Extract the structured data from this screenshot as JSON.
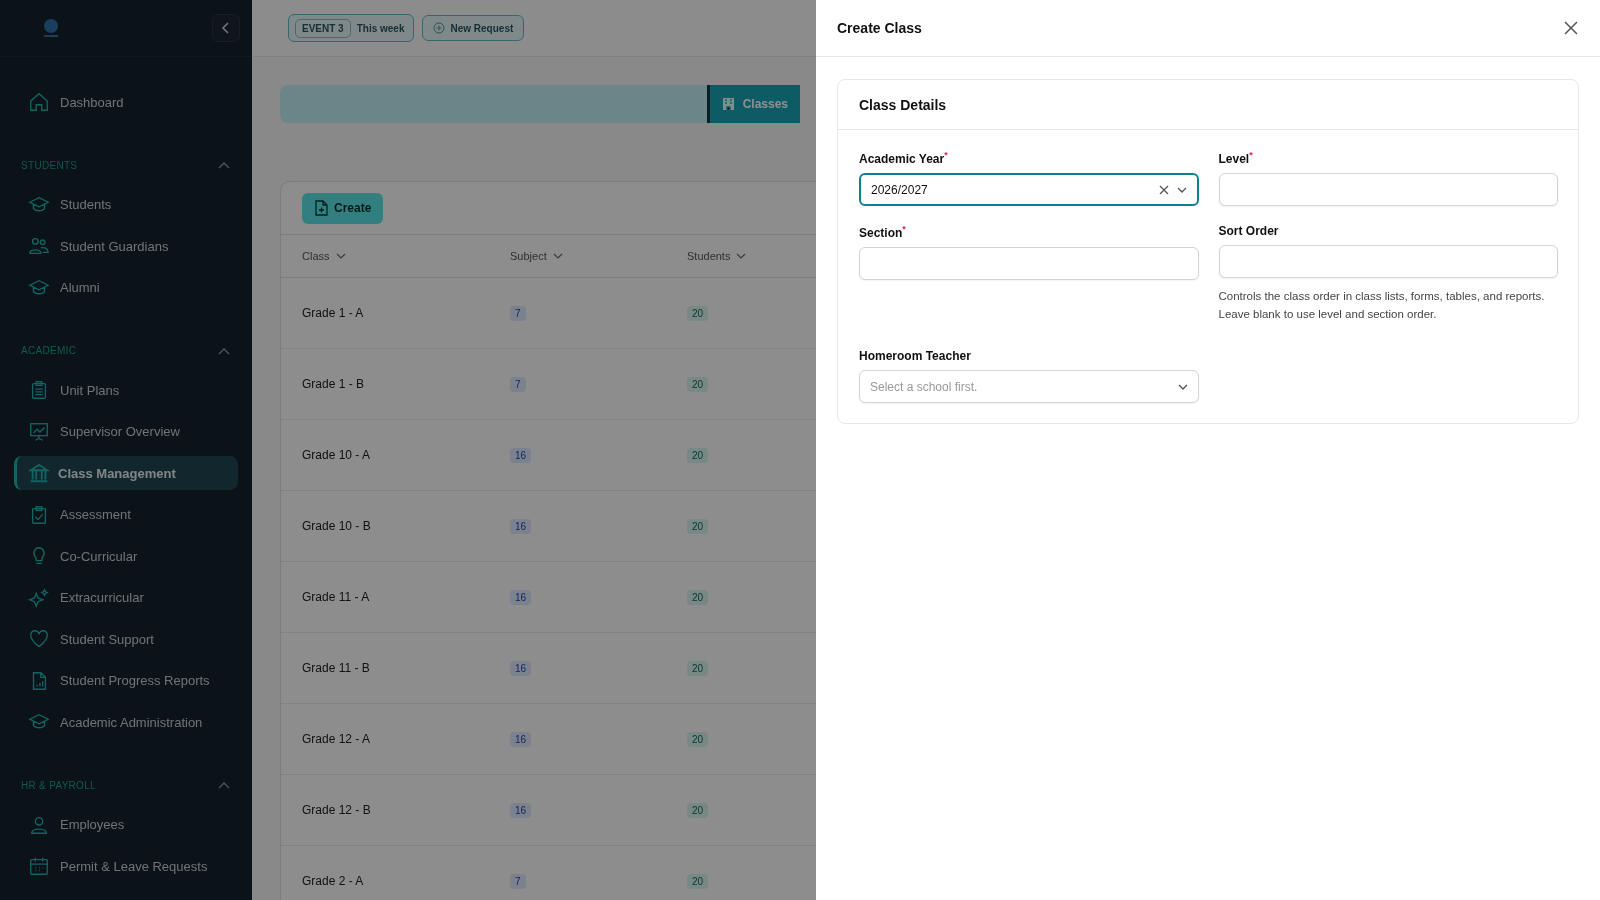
{
  "sidebar": {
    "groups": [
      {
        "items": [
          {
            "label": "Dashboard",
            "selected": false
          }
        ]
      },
      {
        "title": "STUDENTS",
        "expanded": true,
        "items": [
          {
            "label": "Students",
            "selected": false
          },
          {
            "label": "Student Guardians",
            "selected": false
          },
          {
            "label": "Alumni",
            "selected": false
          }
        ]
      },
      {
        "title": "ACADEMIC",
        "expanded": true,
        "items": [
          {
            "label": "Unit Plans",
            "selected": false
          },
          {
            "label": "Supervisor Overview",
            "selected": false
          },
          {
            "label": "Class Management",
            "selected": true
          },
          {
            "label": "Assessment",
            "selected": false
          },
          {
            "label": "Co-Curricular",
            "selected": false
          },
          {
            "label": "Extracurricular",
            "selected": false
          },
          {
            "label": "Student Support",
            "selected": false
          },
          {
            "label": "Student Progress Reports",
            "selected": false
          },
          {
            "label": "Academic Administration",
            "selected": false
          }
        ]
      },
      {
        "title": "HR & PAYROLL",
        "expanded": true,
        "items": [
          {
            "label": "Employees",
            "selected": false
          },
          {
            "label": "Permit & Leave Requests",
            "selected": false
          }
        ]
      }
    ]
  },
  "topbar": {
    "event_badge": "EVENT 3",
    "event_label": "This week",
    "new_request": "New Request"
  },
  "page_tabs": [
    {
      "label": "Classes",
      "selected": true
    }
  ],
  "create_button": "Create",
  "table": {
    "columns": [
      "Class",
      "Subject",
      "Students"
    ],
    "rows": [
      {
        "class": "Grade 1 - A",
        "subject": "7",
        "students": "20"
      },
      {
        "class": "Grade 1 - B",
        "subject": "7",
        "students": "20"
      },
      {
        "class": "Grade 10 - A",
        "subject": "16",
        "students": "20"
      },
      {
        "class": "Grade 10 - B",
        "subject": "16",
        "students": "20"
      },
      {
        "class": "Grade 11 - A",
        "subject": "16",
        "students": "20"
      },
      {
        "class": "Grade 11 - B",
        "subject": "16",
        "students": "20"
      },
      {
        "class": "Grade 12 - A",
        "subject": "16",
        "students": "20"
      },
      {
        "class": "Grade 12 - B",
        "subject": "16",
        "students": "20"
      },
      {
        "class": "Grade 2 - A",
        "subject": "7",
        "students": "20"
      }
    ]
  },
  "drawer": {
    "title": "Create Class",
    "card_title": "Class Details",
    "fields": [
      {
        "label": "Academic Year$^{*}$",
        "kind": "select",
        "value": "2026/2027",
        "clearable": true,
        "focused": true
      },
      {
        "label": "Level$^{*}$",
        "kind": "text",
        "focused": false
      },
      {
        "label": "Section$^{*}$",
        "kind": "text",
        "focused": false
      },
      {
        "label": "Sort Order",
        "kind": "text",
        "focused": false,
        "help": "Controls the class order in class lists, forms, tables, and reports. Leave blank to use level and section order."
      },
      {
        "label": "Homeroom Teacher",
        "kind": "select",
        "placeholder": "Select a school first.",
        "clearable": false,
        "focused": false
      }
    ]
  }
}
